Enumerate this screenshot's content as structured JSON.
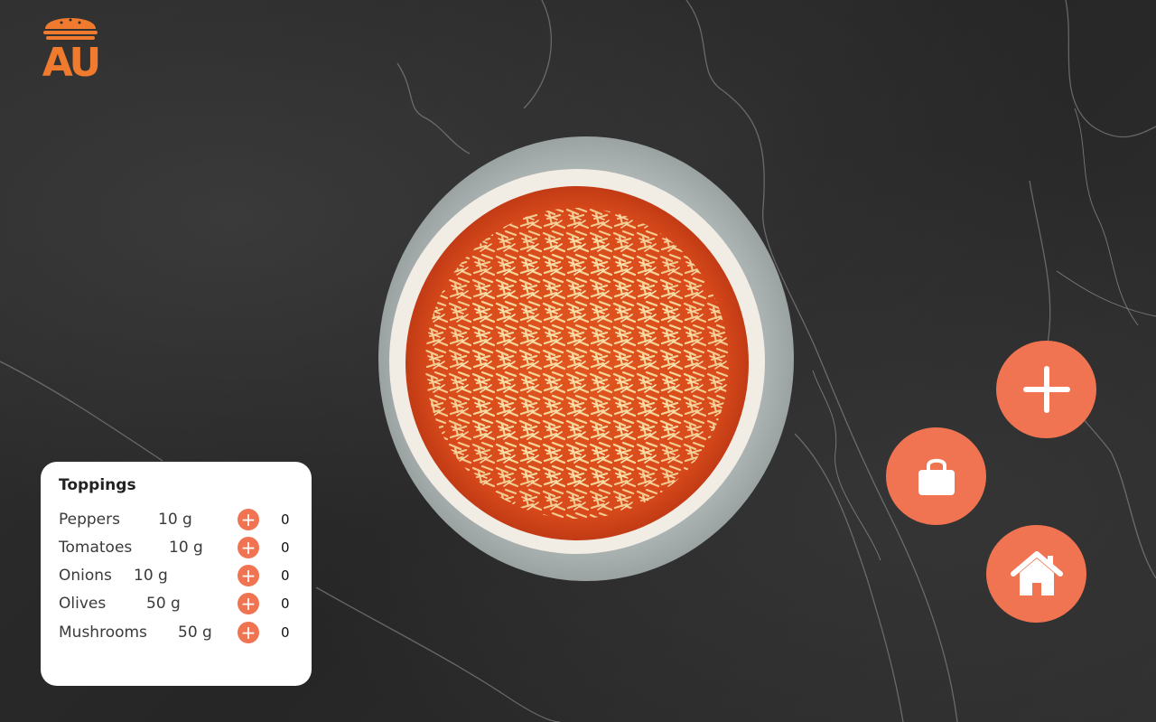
{
  "logo": {
    "text": "AU",
    "icon": "burger-icon",
    "color": "#f07a2e"
  },
  "toppings": {
    "title": "Toppings",
    "items": [
      {
        "name": "Peppers",
        "weight": "10 g",
        "count": "0"
      },
      {
        "name": "Tomatoes",
        "weight": "10 g",
        "count": "0"
      },
      {
        "name": "Onions",
        "weight": "10 g",
        "count": "0"
      },
      {
        "name": "Olives",
        "weight": "50 g",
        "count": "0"
      },
      {
        "name": "Mushrooms",
        "weight": "50 g",
        "count": "0"
      }
    ],
    "add_icon": "plus-icon"
  },
  "actions": {
    "add": "plus-icon",
    "cart": "shopping-bag-icon",
    "home": "home-icon"
  },
  "colors": {
    "accent": "#f07452",
    "logo": "#f07a2e",
    "card": "#ffffff",
    "background": "#2b2b2b"
  }
}
